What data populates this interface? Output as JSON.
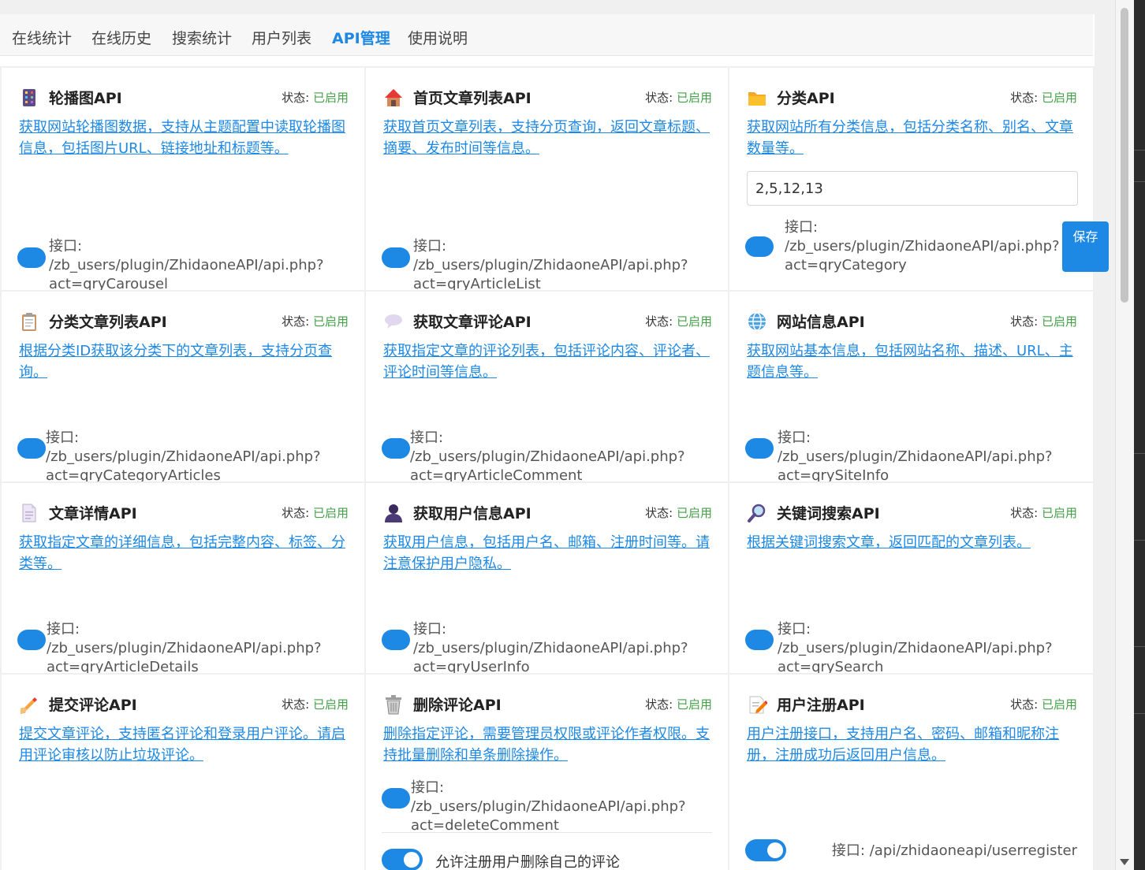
{
  "nav": {
    "tabs": [
      {
        "label": "在线统计"
      },
      {
        "label": "在线历史"
      },
      {
        "label": "搜索统计"
      },
      {
        "label": "用户列表"
      },
      {
        "label": "API管理"
      },
      {
        "label": "使用说明"
      }
    ],
    "active_index": 4
  },
  "status_prefix": "状态: ",
  "status_enabled": "已启用",
  "endpoint_prefix": "接口:",
  "save_label": "保存",
  "cards": [
    {
      "icon": "carousel-icon",
      "title": "轮播图API",
      "desc": "获取网站轮播图数据，支持从主题配置中读取轮播图信息，包括图片URL、链接地址和标题等。",
      "endpoint": "/zb_users/plugin/ZhidaoneAPI/api.php?act=qryCarousel"
    },
    {
      "icon": "home-icon",
      "title": "首页文章列表API",
      "desc": "获取首页文章列表，支持分页查询，返回文章标题、摘要、发布时间等信息。",
      "endpoint": "/zb_users/plugin/ZhidaoneAPI/api.php?act=qryArticleList"
    },
    {
      "icon": "folder-icon",
      "title": "分类API",
      "desc": "获取网站所有分类信息，包括分类名称、别名、文章数量等。",
      "input_value": "2,5,12,13",
      "endpoint": "/zb_users/plugin/ZhidaoneAPI/api.php?act=qryCategory"
    },
    {
      "icon": "clipboard-icon",
      "title": "分类文章列表API",
      "desc": "根据分类ID获取该分类下的文章列表，支持分页查询。",
      "endpoint": "/zb_users/plugin/ZhidaoneAPI/api.php?act=qryCategoryArticles"
    },
    {
      "icon": "speech-bubble-icon",
      "title": "获取文章评论API",
      "desc": "获取指定文章的评论列表，包括评论内容、评论者、评论时间等信息。",
      "endpoint": "/zb_users/plugin/ZhidaoneAPI/api.php?act=qryArticleComment"
    },
    {
      "icon": "globe-icon",
      "title": "网站信息API",
      "desc": "获取网站基本信息，包括网站名称、描述、URL、主题信息等。",
      "endpoint": "/zb_users/plugin/ZhidaoneAPI/api.php?act=qrySiteInfo"
    },
    {
      "icon": "document-icon",
      "title": "文章详情API",
      "desc": "获取指定文章的详细信息，包括完整内容、标签、分类等。",
      "endpoint": "/zb_users/plugin/ZhidaoneAPI/api.php?act=qryArticleDetails"
    },
    {
      "icon": "user-icon",
      "title": "获取用户信息API",
      "desc": "获取用户信息，包括用户名、邮箱、注册时间等。请注意保护用户隐私。",
      "endpoint": "/zb_users/plugin/ZhidaoneAPI/api.php?act=qryUserInfo"
    },
    {
      "icon": "magnifier-icon",
      "title": "关键词搜索API",
      "desc": "根据关键词搜索文章，返回匹配的文章列表。",
      "endpoint": "/zb_users/plugin/ZhidaoneAPI/api.php?act=qrySearch"
    },
    {
      "icon": "writing-hand-icon",
      "title": "提交评论API",
      "desc": "提交文章评论，支持匿名评论和登录用户评论。请启用评论审核以防止垃圾评论。"
    },
    {
      "icon": "trash-icon",
      "title": "删除评论API",
      "desc": "删除指定评论，需要管理员权限或评论作者权限。支持批量删除和单条删除操作。",
      "endpoint": "/zb_users/plugin/ZhidaoneAPI/api.php?act=deleteComment",
      "option_label": "允许注册用户删除自己的评论"
    },
    {
      "icon": "memo-icon",
      "title": "用户注册API",
      "desc": "用户注册接口，支持用户名、密码、邮箱和昵称注册，注册成功后返回用户信息。",
      "endpoint": "/api/zhidaoneapi/userregister"
    }
  ]
}
